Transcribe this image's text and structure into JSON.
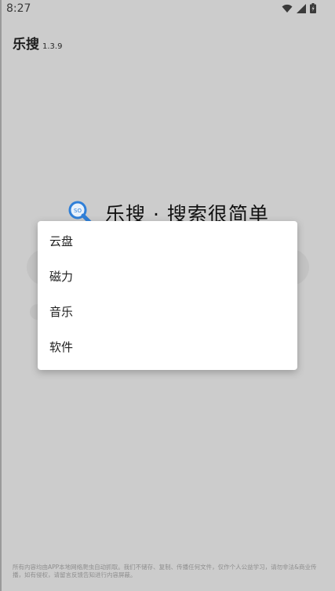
{
  "status_bar": {
    "time": "8:27",
    "icons": [
      "wifi-icon",
      "signal-icon",
      "battery-icon"
    ]
  },
  "app": {
    "name": "乐搜",
    "version": "1.3.9"
  },
  "logo": {
    "icon": "magnifier-logo-icon",
    "slogan": "乐搜 · 搜索很简单"
  },
  "dialog": {
    "options": [
      {
        "label": "云盘"
      },
      {
        "label": "磁力"
      },
      {
        "label": "音乐"
      },
      {
        "label": "软件"
      }
    ]
  },
  "footer": {
    "disclaimer": "所有内容均由APP本地网络爬虫自动抓取。我们不储存、复制、传播任何文件，仅作个人公益学习，请勿非法&商业传播，如有侵权，请留言反馈告知进行内容屏蔽。"
  },
  "colors": {
    "overlay_background": "#cccccc",
    "dialog_background": "#ffffff",
    "logo_blue": "#2f7fd8"
  }
}
